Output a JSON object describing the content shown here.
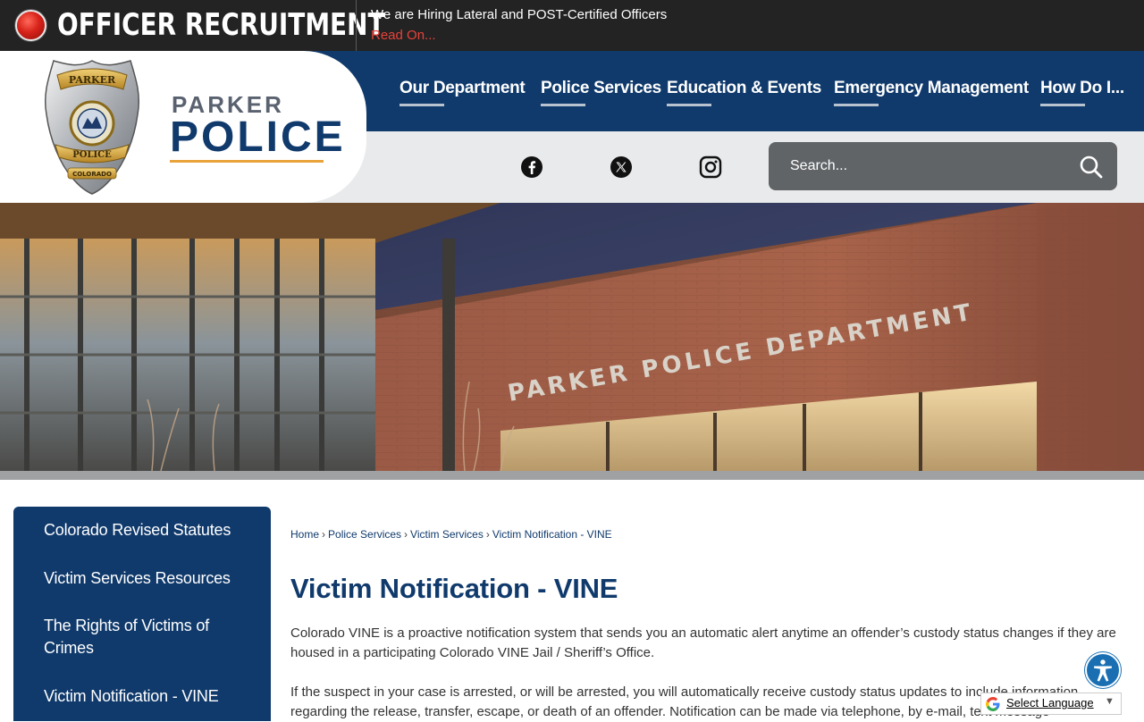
{
  "alert": {
    "title": "OFFICER RECRUITMENT",
    "message": "We are Hiring Lateral and POST-Certified Officers",
    "link": "Read On..."
  },
  "brand": {
    "top": "PARKER",
    "main": "POLICE",
    "badge_top": "PARKER",
    "badge_mid": "POLICE",
    "badge_bottom": "COLORADO"
  },
  "nav": {
    "items": [
      {
        "label": "Our Department"
      },
      {
        "label": "Police Services"
      },
      {
        "label": "Education & Events"
      },
      {
        "label": "Emergency Management"
      },
      {
        "label": "How Do I..."
      }
    ]
  },
  "social": {
    "icons": [
      "facebook-icon",
      "x-twitter-icon",
      "instagram-icon"
    ]
  },
  "search": {
    "placeholder": "Search..."
  },
  "hero": {
    "building_sign": "PARKER POLICE DEPARTMENT"
  },
  "sidebar": {
    "items": [
      {
        "label": "Colorado Revised Statutes"
      },
      {
        "label": "Victim Services Resources"
      },
      {
        "label": "The Rights of Victims of Crimes"
      },
      {
        "label": "Victim Notification - VINE"
      }
    ]
  },
  "breadcrumb": {
    "items": [
      "Home",
      "Police Services",
      "Victim Services",
      "Victim Notification - VINE"
    ],
    "separator": "›"
  },
  "main": {
    "title": "Victim Notification - VINE",
    "paragraphs": [
      "Colorado VINE is a proactive notification system that sends you an automatic alert anytime an offender’s custody status changes if they are housed in a participating Colorado VINE Jail / Sheriff’s Office.",
      "If the suspect in your case is arrested, or will be arrested, you will automatically receive custody status updates to include information regarding the release, transfer, escape, or death of an offender. Notification can be made via telephone, by e-mail, text message"
    ]
  },
  "translate": {
    "label": "Select Language",
    "arrow": "▼"
  },
  "colors": {
    "navy": "#103a6c",
    "alert_red": "#e8423a",
    "accent_gold": "#e8a33a",
    "dark_bar": "#232323"
  }
}
